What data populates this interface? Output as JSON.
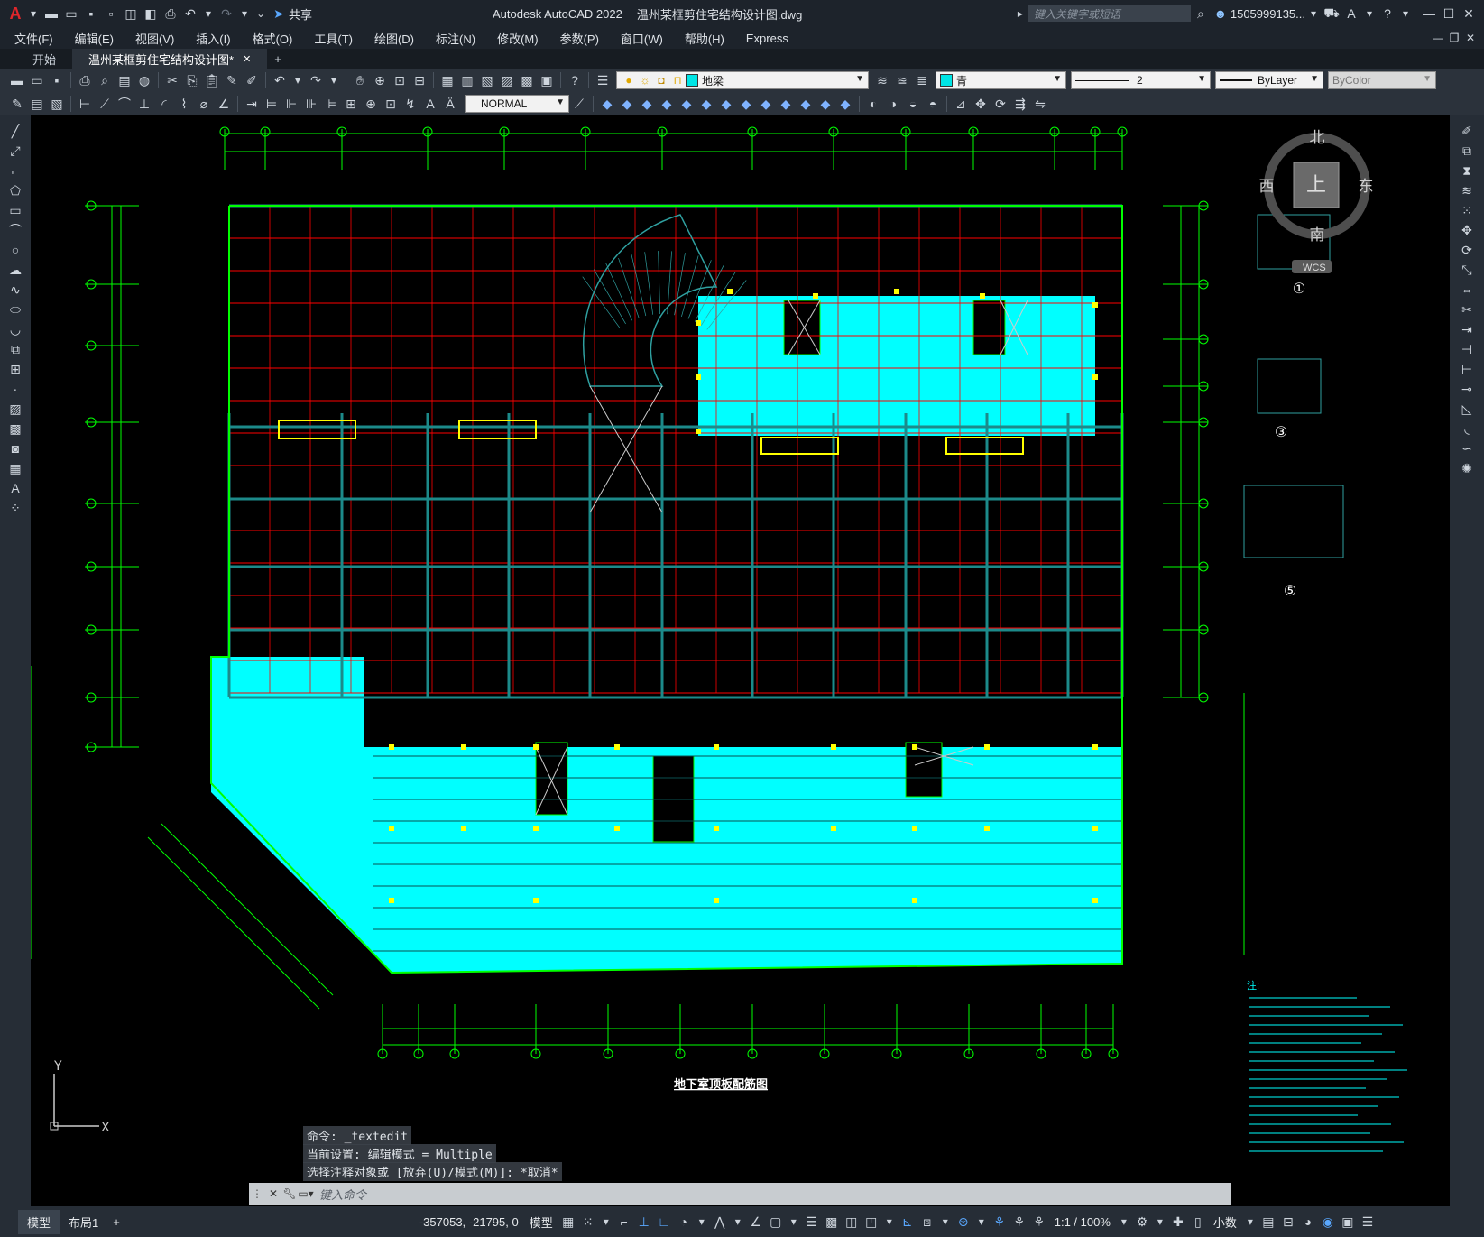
{
  "titlebar": {
    "app_title": "Autodesk AutoCAD 2022",
    "file_name": "温州某框剪住宅结构设计图.dwg",
    "share_label": "共享",
    "search_placeholder": "键入关键字或短语",
    "user": "1505999135...",
    "accent": "#e0262b"
  },
  "menu": {
    "items": [
      "文件(F)",
      "编辑(E)",
      "视图(V)",
      "插入(I)",
      "格式(O)",
      "工具(T)",
      "绘图(D)",
      "标注(N)",
      "修改(M)",
      "参数(P)",
      "窗口(W)",
      "帮助(H)",
      "Express"
    ]
  },
  "tabs": {
    "start": "开始",
    "drawing": "温州某框剪住宅结构设计图*",
    "add": "+"
  },
  "toolbar": {
    "layer_name": "地梁",
    "layer_color_hex": "#00e5e5",
    "color_name": "青",
    "lineweight": "2",
    "linetype": "ByLayer",
    "plotstyle": "ByColor",
    "textstyle": "NORMAL"
  },
  "viewcube": {
    "north": "北",
    "south": "南",
    "east": "东",
    "west": "西",
    "top": "上",
    "wcs": "WCS"
  },
  "drawing": {
    "plan_title": "地下室顶板配筋图",
    "detail_1": "①",
    "detail_3": "③",
    "detail_5": "⑤",
    "notes_heading": "注:",
    "colors": {
      "cyan": "#00ffff",
      "green": "#00ff00",
      "red": "#ff0000",
      "yellow": "#ffff00",
      "magenta": "#ff00ff"
    }
  },
  "command": {
    "history": [
      "命令: _textedit",
      "当前设置: 编辑模式 = Multiple",
      "选择注释对象或 [放弃(U)/模式(M)]: *取消*"
    ],
    "placeholder": "键入命令"
  },
  "status": {
    "model_tab": "模型",
    "layout_tab": "布局1",
    "add_layout": "+",
    "coords": "-357053, -21795, 0",
    "model_label": "模型",
    "scale": "1:1 / 100%",
    "units": "小数"
  }
}
